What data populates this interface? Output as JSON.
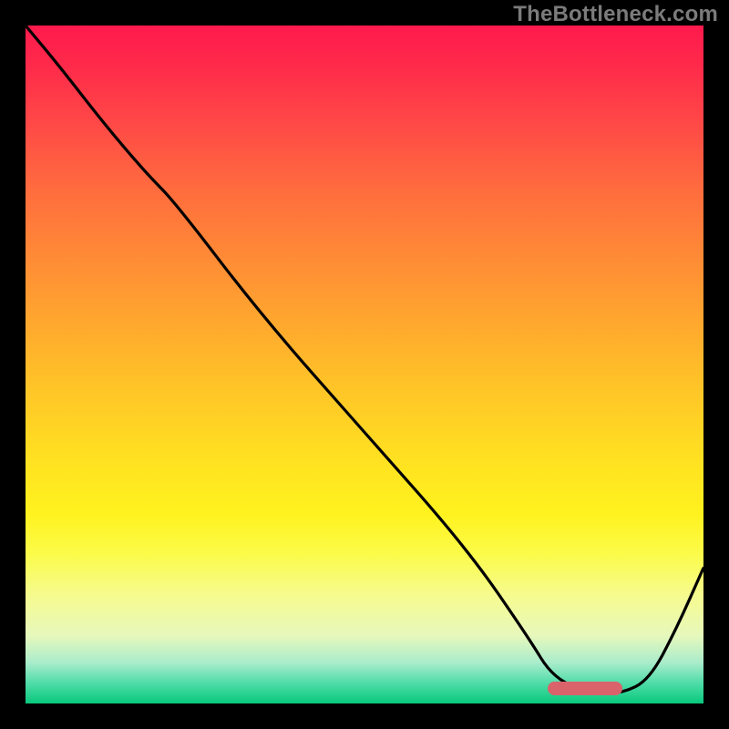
{
  "watermark": "TheBottleneck.com",
  "colors": {
    "background": "#000000",
    "watermark": "#7b7b7b",
    "curve_stroke": "#000000",
    "marker": "#d9626b",
    "gradient_top": "#ff1a4d",
    "gradient_bottom": "#08c97c"
  },
  "chart_data": {
    "type": "line",
    "title": "",
    "xlabel": "",
    "ylabel": "",
    "xlim": [
      0,
      100
    ],
    "ylim": [
      0,
      100
    ],
    "grid": false,
    "series": [
      {
        "name": "bottleneck-curve",
        "x": [
          0,
          5,
          12,
          18,
          22,
          35,
          50,
          65,
          74,
          78,
          84,
          88,
          92,
          96,
          100
        ],
        "values": [
          100,
          94,
          85,
          78,
          74,
          57,
          40,
          23,
          10,
          3.5,
          1.5,
          1.5,
          3.5,
          11,
          20
        ]
      }
    ],
    "annotations": [
      {
        "name": "optimal-region-marker",
        "type": "bar",
        "x_start": 77,
        "x_end": 88,
        "y": 2.3,
        "color": "#d9626b"
      }
    ],
    "legend": false
  }
}
